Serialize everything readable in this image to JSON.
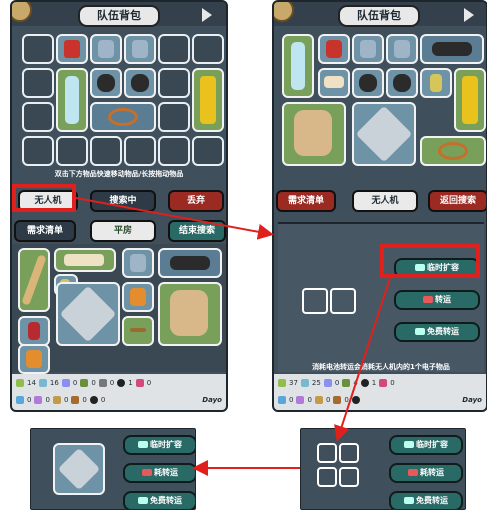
{
  "left_screen": {
    "header_title": "队伍背包",
    "hint": "双击下方物品快速移动物品/长按拖动物品",
    "buttons": {
      "drone": "无人机",
      "searching": "搜索中",
      "discard": "丢弃",
      "demand_list": "需求清单",
      "flat_house": "平房",
      "end_search": "结束搜索"
    },
    "status_row1": [
      "14",
      "16",
      "0",
      "0",
      "0",
      "1",
      "0"
    ],
    "status_row2": [
      "0",
      "0",
      "0",
      "0",
      "0",
      "Dayo"
    ]
  },
  "right_screen": {
    "header_title": "队伍背包",
    "buttons": {
      "demand_list": "需求清单",
      "drone": "无人机",
      "return_search": "返回搜索"
    },
    "drone_actions": {
      "temp_expand": "临时扩容",
      "battery_transfer": "转运",
      "free_transfer": "免费转运"
    },
    "hint": "消耗电池转运会消耗无人机内的1个电子物品",
    "status_row1": [
      "37",
      "25",
      "0",
      "4",
      "1",
      "0"
    ],
    "status_row2": [
      "0",
      "0",
      "0",
      "0",
      "Dayo"
    ]
  },
  "bottom_left": {
    "temp_expand": "临时扩容",
    "battery_transfer": "转运",
    "battery_prefix": "耗",
    "free_transfer": "免费转运"
  },
  "bottom_right": {
    "temp_expand": "临时扩容",
    "battery_transfer": "转运",
    "battery_prefix": "耗",
    "free_transfer": "免费转运"
  },
  "colors": {
    "annotation_red": "#e0201c",
    "panel_bg": "#3f4f5c",
    "teal_button": "#2a6a66"
  }
}
